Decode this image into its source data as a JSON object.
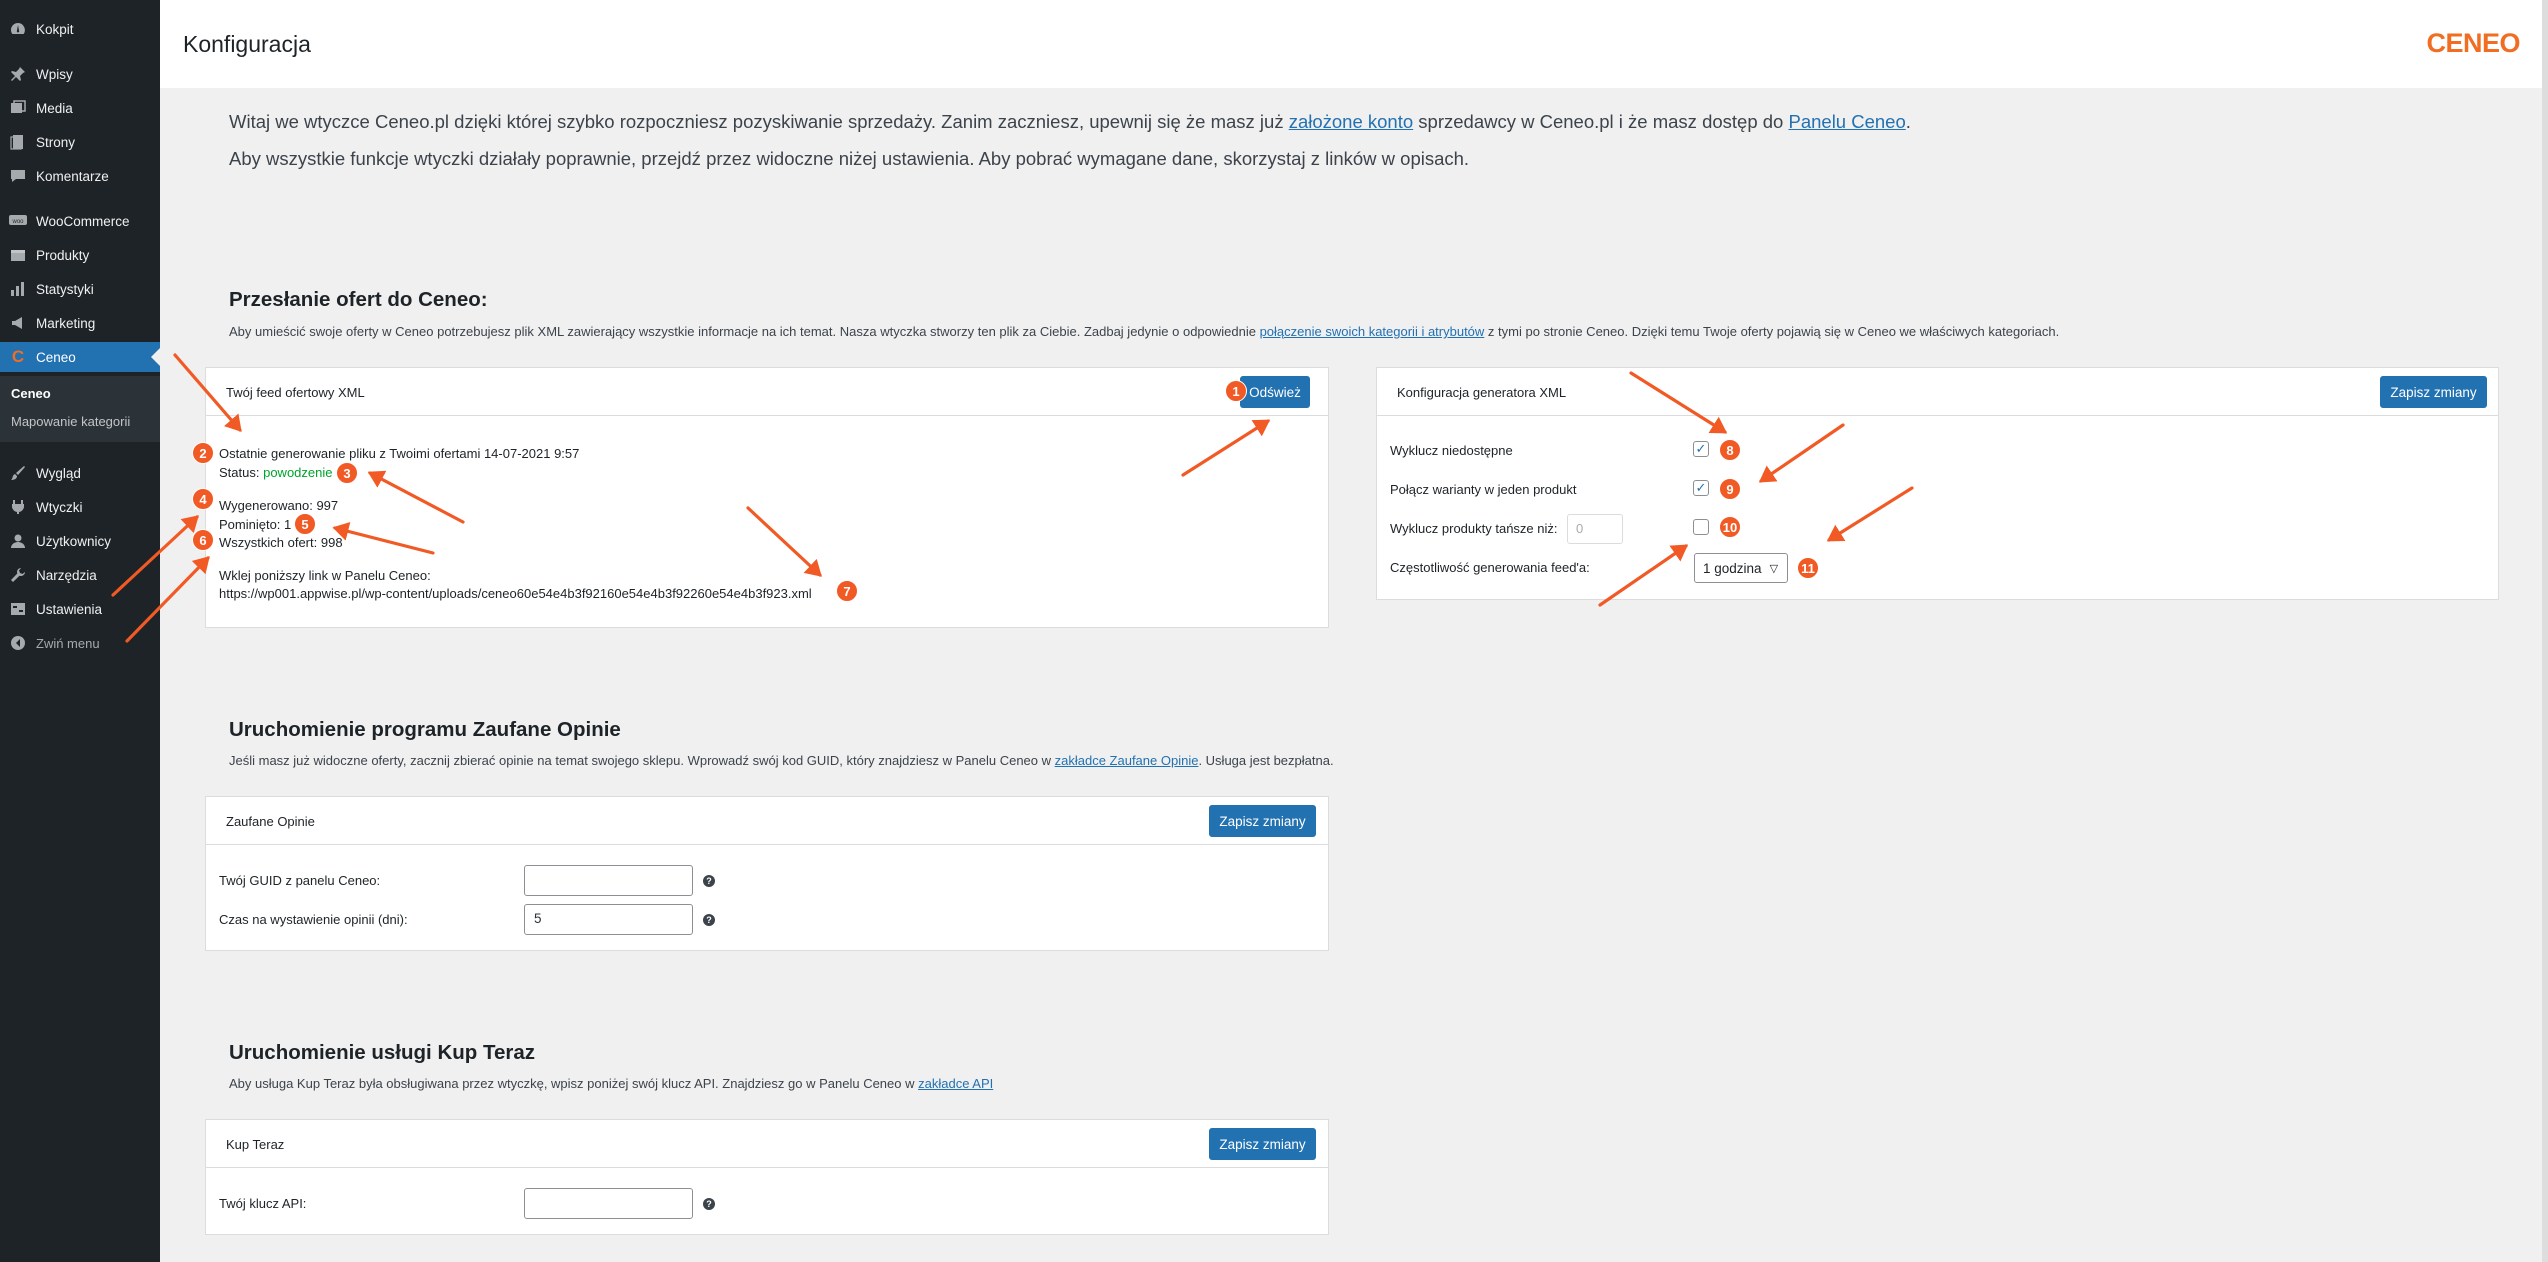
{
  "sidebar": {
    "items": [
      {
        "label": "Kokpit",
        "icon": "dashboard-icon"
      },
      {
        "label": "Wpisy",
        "icon": "pin-icon"
      },
      {
        "label": "Media",
        "icon": "media-icon"
      },
      {
        "label": "Strony",
        "icon": "page-icon"
      },
      {
        "label": "Komentarze",
        "icon": "comment-icon"
      },
      {
        "label": "WooCommerce",
        "icon": "woo-icon"
      },
      {
        "label": "Produkty",
        "icon": "box-icon"
      },
      {
        "label": "Statystyki",
        "icon": "chart-icon"
      },
      {
        "label": "Marketing",
        "icon": "megaphone-icon"
      },
      {
        "label": "Ceneo",
        "icon": "ceneo-icon"
      },
      {
        "label": "Wygląd",
        "icon": "brush-icon"
      },
      {
        "label": "Wtyczki",
        "icon": "plug-icon"
      },
      {
        "label": "Użytkownicy",
        "icon": "user-icon"
      },
      {
        "label": "Narzędzia",
        "icon": "wrench-icon"
      },
      {
        "label": "Ustawienia",
        "icon": "settings-icon"
      }
    ],
    "submenu": [
      "Ceneo",
      "Mapowanie kategorii"
    ],
    "collapse_label": "Zwiń menu"
  },
  "header": {
    "title": "Konfiguracja",
    "logo": "CENEO"
  },
  "intro": {
    "line1_a": "Witaj we wtyczce Ceneo.pl dzięki której szybko rozpoczniesz pozyskiwanie sprzedaży. Zanim zaczniesz, upewnij się że masz już ",
    "line1_link1": "założone konto",
    "line1_b": " sprzedawcy w Ceneo.pl i że masz dostęp do ",
    "line1_link2": "Panelu Ceneo",
    "line1_c": ".",
    "line2": "Aby wszystkie funkcje wtyczki działały poprawnie, przejdź przez widoczne niżej ustawienia. Aby pobrać wymagane dane, skorzystaj z linków w opisach."
  },
  "offers": {
    "title": "Przesłanie ofert do Ceneo:",
    "desc_a": "Aby umieścić swoje oferty w Ceneo potrzebujesz plik XML zawierający wszystkie informacje na ich temat. Nasza wtyczka stworzy ten plik za Ciebie. Zadbaj jedynie o odpowiednie ",
    "desc_link": "połączenie swoich kategorii i atrybutów",
    "desc_b": " z tymi po stronie Ceneo. Dzięki temu Twoje oferty pojawią się w Ceneo we właściwych kategoriach.",
    "feed_panel": {
      "title": "Twój feed ofertowy XML",
      "refresh_label": "Odśwież",
      "last_gen_label": "Ostatnie generowanie pliku z Twoimi ofertami",
      "last_gen_value": "14-07-2021 9:57",
      "status_label": "Status:",
      "status_value": "powodzenie",
      "generated_label": "Wygenerowano:",
      "generated_value": "997",
      "skipped_label": "Pominięto:",
      "skipped_value": "1",
      "total_label": "Wszystkich ofert:",
      "total_value": "998",
      "link_label": "Wklej poniższy link w Panelu Ceneo:",
      "link_value": "https://wp001.appwise.pl/wp-content/uploads/ceneo60e54e4b3f92160e54e4b3f92260e54e4b3f923.xml"
    },
    "xml_panel": {
      "title": "Konfiguracja generatora XML",
      "save_label": "Zapisz zmiany",
      "exclude_unavailable_label": "Wyklucz niedostępne",
      "exclude_unavailable": true,
      "merge_variants_label": "Połącz warianty w jeden produkt",
      "merge_variants": true,
      "exclude_cheaper_label": "Wyklucz produkty tańsze niż:",
      "exclude_cheaper": false,
      "exclude_cheaper_value": "0",
      "frequency_label": "Częstotliwość generowania feed'a:",
      "frequency_value": "1 godzina"
    }
  },
  "opinions": {
    "title": "Uruchomienie programu Zaufane Opinie",
    "desc_a": "Jeśli masz już widoczne oferty, zacznij zbierać opinie na temat swojego sklepu. Wprowadź swój kod GUID, który znajdziesz w Panelu Ceneo w ",
    "desc_link": "zakładce Zaufane Opinie",
    "desc_b": ". Usługa jest bezpłatna.",
    "panel_title": "Zaufane Opinie",
    "save_label": "Zapisz zmiany",
    "guid_label": "Twój GUID z panelu Ceneo:",
    "guid_value": "",
    "days_label": "Czas na wystawienie opinii (dni):",
    "days_value": "5"
  },
  "buynow": {
    "title": "Uruchomienie usługi Kup Teraz",
    "desc_a": "Aby usługa Kup Teraz była obsługiwana przez wtyczkę, wpisz poniżej swój klucz API. Znajdziesz go w Panelu Ceneo w ",
    "desc_link": "zakładce API",
    "panel_title": "Kup Teraz",
    "save_label": "Zapisz zmiany",
    "api_label": "Twój klucz API:",
    "api_value": ""
  },
  "annotations": [
    "1",
    "2",
    "3",
    "4",
    "5",
    "6",
    "7",
    "8",
    "9",
    "10",
    "11"
  ],
  "colors": {
    "accent": "#2271b1",
    "sidebar": "#1d2327",
    "annotation": "#f15a24",
    "success": "#00a32a",
    "brand": "#f16d22"
  }
}
